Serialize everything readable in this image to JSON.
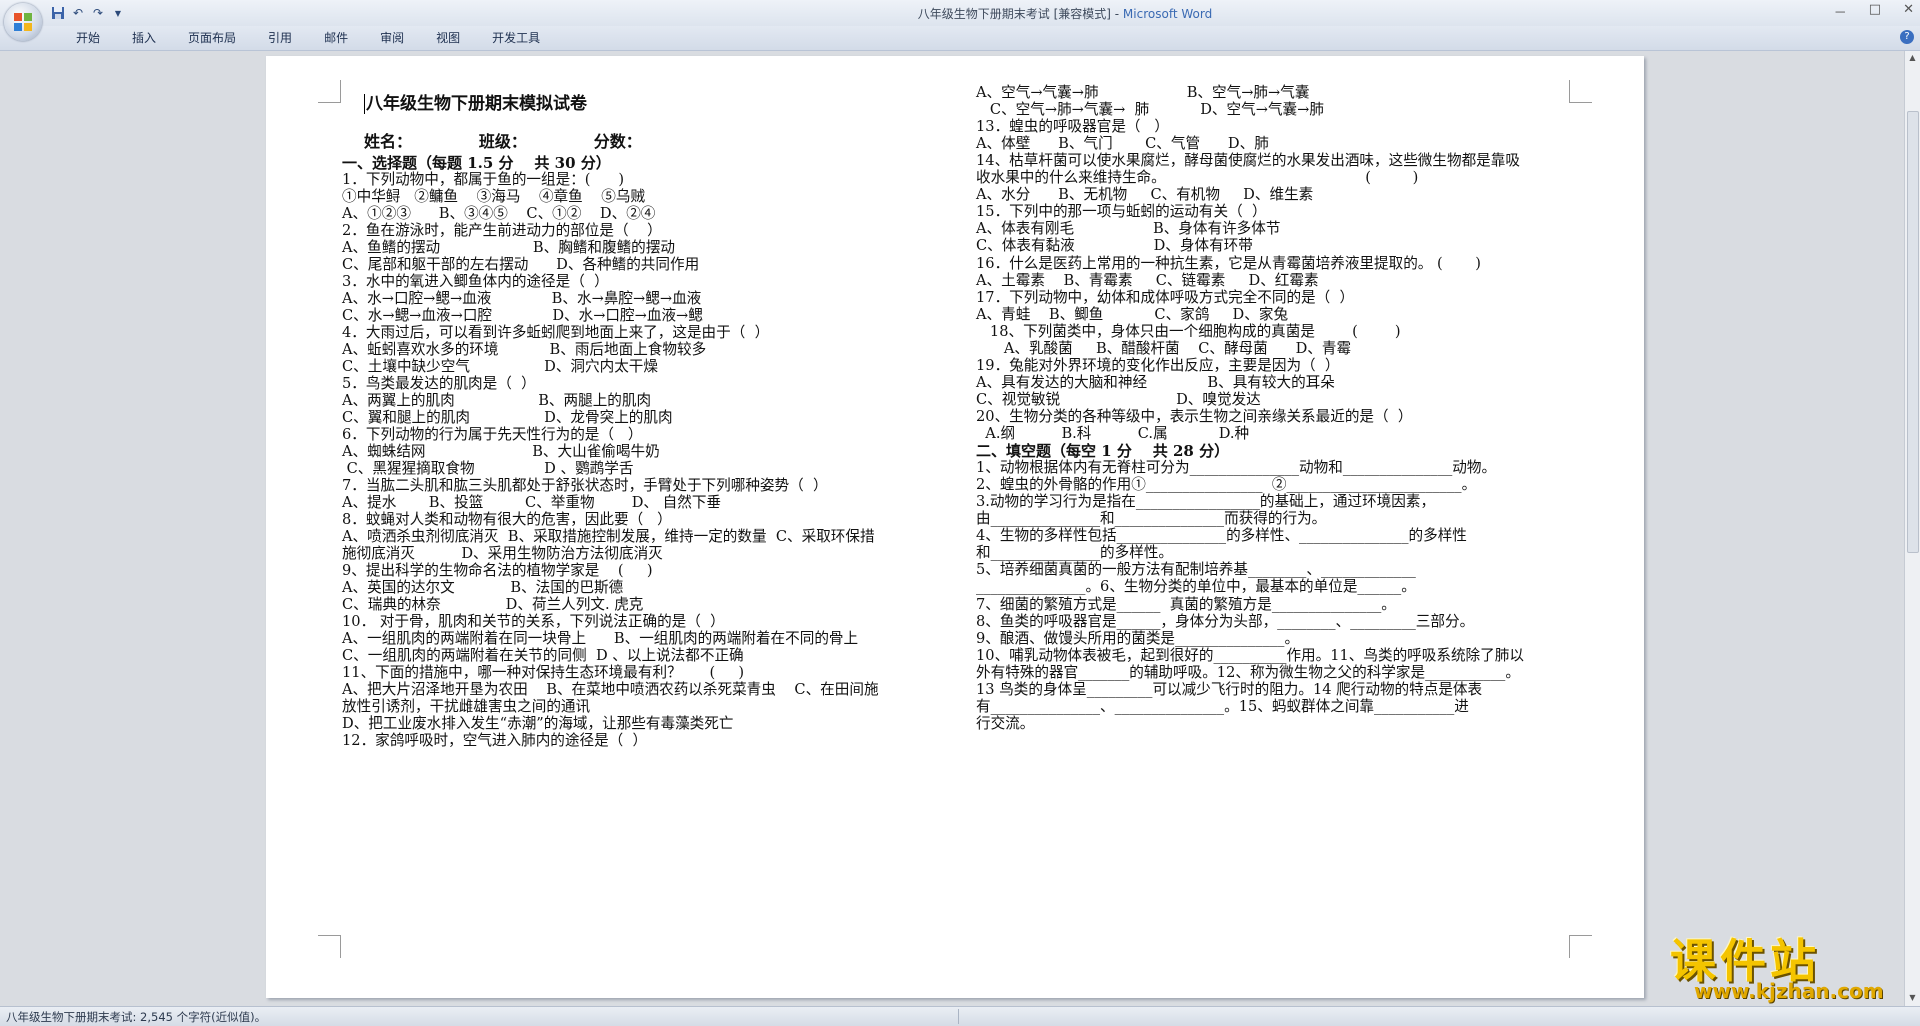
{
  "window": {
    "title": "八年级生物下册期末考试 [兼容模式] - ",
    "app_name": "Microsoft Word",
    "controls": [
      "－",
      "□",
      "✕"
    ]
  },
  "qat": {
    "save_icon": "save-icon",
    "undo_icon": "undo-icon",
    "redo_icon": "redo-icon",
    "customize_icon": "dropdown-icon"
  },
  "ribbon": {
    "tabs": [
      "开始",
      "插入",
      "页面布局",
      "引用",
      "邮件",
      "审阅",
      "视图",
      "开发工具"
    ],
    "help": "?"
  },
  "document": {
    "heading": "八年级生物下册期末模拟试卷",
    "name_line": "姓名：            班级：            分数：",
    "left_column": [
      "一、选择题（每题 1.5 分    共 30 分）",
      "1．下列动物中，都属于鱼的一组是：(      )",
      "①中华鲟   ②鳙鱼    ③海马    ④章鱼    ⑤乌贼",
      "A、①②③      B、③④⑤    C、①②    D、②④",
      "2．鱼在游泳时，能产生前进动力的部位是（    ）",
      "A、鱼鳍的摆动                    B、胸鳍和腹鳍的摆动",
      "C、尾部和躯干部的左右摆动      D、各种鳍的共同作用",
      "3．水中的氧进入鲫鱼体内的途径是（  ）",
      "A、水→口腔→鳃→血液             B、水→鼻腔→鳃→血液",
      "C、水→鳃→血液→口腔             D、水→口腔→血液→鳃",
      "4．大雨过后，可以看到许多蚯蚓爬到地面上来了，这是由于（  ）",
      "A、蚯蚓喜欢水多的环境           B、雨后地面上食物较多",
      "C、土壤中缺少空气                D、洞穴内太干燥",
      "5．鸟类最发达的肌肉是（  ）",
      "A、两翼上的肌肉                  B、两腿上的肌肉",
      "C、翼和腿上的肌肉                D、龙骨突上的肌肉",
      "6．下列动物的行为属于先天性行为的是（   ）",
      "A、蜘蛛结网                       B、大山雀偷喝牛奶",
      " C、黑猩猩摘取食物               D 、鹦鹉学舌",
      "7．当肱二头肌和肱三头肌都处于舒张状态时，手臂处于下列哪种姿势（  ）",
      "A、提水       B、投篮         C、举重物        D、 自然下垂",
      "8．蚊蝇对人类和动物有很大的危害，因此要（   ）",
      "A、喷洒杀虫剂彻底消灭  B、采取措施控制发展，维持一定的数量  C、采取环保措",
      "施彻底消灭          D、采用生物防治方法彻底消灭",
      "9、提出科学的生物命名法的植物学家是    (     )",
      "A、英国的达尔文            B、法国的巴斯德",
      "C、瑞典的林奈              D、荷兰人列文. 虎克",
      "10． 对于骨，肌肉和关节的关系，下列说法正确的是（  ）",
      "A、一组肌肉的两端附着在同一块骨上      B、一组肌肉的两端附着在不同的骨上",
      "C、一组肌肉的两端附着在关节的同侧  D 、以上说法都不正确",
      "11、下面的措施中，哪一种对保持生态环境最有利？      (     )",
      "A、把大片沼泽地开垦为农田    B、在菜地中喷洒农药以杀死菜青虫    C、在田间施",
      "放性引诱剂，干扰雌雄害虫之间的通讯",
      "D、把工业废水排入发生“赤潮”的海域，让那些有毒藻类死亡",
      "12．家鸽呼吸时，空气进入肺内的途径是（  ）"
    ],
    "right_column": [
      "A、空气→气囊→肺                   B、空气→肺→气囊",
      "   C、空气→肺→气囊→  肺           D、空气→气囊→肺",
      "13．蝗虫的呼吸器官是（   ）",
      "A、体壁      B、气门       C、气管      D、肺",
      "14、枯草杆菌可以使水果腐烂，酵母菌使腐烂的水果发出酒味，这些微生物都是靠吸",
      "收水果中的什么来维持生命。                                           (         )",
      "A、水分      B、无机物     C、有机物     D、维生素",
      "15．下列中的那一项与蚯蚓的运动有关（  ）",
      "A、体表有刚毛                 B、身体有许多体节",
      "C、体表有黏液                 D、身体有环带",
      "16．什么是医药上常用的一种抗生素，它是从青霉菌培养液里提取的。 (       )",
      "A、土霉素    B、青霉素     C、链霉素     D、红霉素",
      "17．下列动物中，幼体和成体呼吸方式完全不同的是（  ）",
      "A、青蛙    B、鲫鱼           C、家鸽     D、家兔",
      "   18、下列菌类中，身体只由一个细胞构成的真菌是        (        )",
      "      A、乳酸菌     B、醋酸杆菌    C、酵母菌      D、青霉",
      "19．兔能对外界环境的变化作出反应，主要是因为（  ）",
      "A、具有发达的大脑和神经             B、具有较大的耳朵",
      "C、视觉敏锐                         D、嗅觉发达",
      "20、生物分类的各种等级中，表示生物之间亲缘关系最近的是（  ）",
      "  A.纲          B.科          C.属           D.种",
      "二、填空题（每空 1 分    共 28 分）",
      "1、动物根据体内有无脊柱可分为_______________动物和_______________动物。",
      "2、蝗虫的外骨骼的作用①________________  ②________________________。",
      "3.动物的学习行为是指在_________________的基础上，通过环境因素，",
      "由_______________和_______________而获得的行为。",
      "4、生物的多样性包括_______________的多样性、_______________的多样性",
      "和_______________的多样性。",
      "5、培养细菌真菌的一般方法有配制培养基________、_____________",
      "_______________。6、生物分类的单位中，最基本的单位是______。",
      "7、细菌的繁殖方式是______  真菌的繁殖方是_______________。",
      "8、鱼类的呼吸器官是______，身体分为头部，________、_________三部分。",
      "9、酿酒、做馒头所用的菌类是_______________。",
      "10、哺乳动物体表被毛，起到很好的__________作用。11、鸟类的呼吸系统除了肺以",
      "外有特殊的器官_______的辅助呼吸。12、称为微生物之父的科学家是___________。",
      "13 鸟类的身体呈_________可以减少飞行时的阻力。14 爬行动物的特点是体表",
      "有_______________、_______________。15、蚂蚁群体之间靠___________进",
      "行交流。"
    ]
  },
  "status_bar": {
    "text": "八年级生物下册期末考试: 2,545 个字符(近似值)。"
  },
  "watermark": {
    "main": "课件站",
    "url": "www.kjzhan.com"
  },
  "colors": {
    "ribbon_bg": "#dbe2ed",
    "title_app": "#3a6ab3",
    "watermark": "#f4c400",
    "red_mark": "#e00000"
  }
}
